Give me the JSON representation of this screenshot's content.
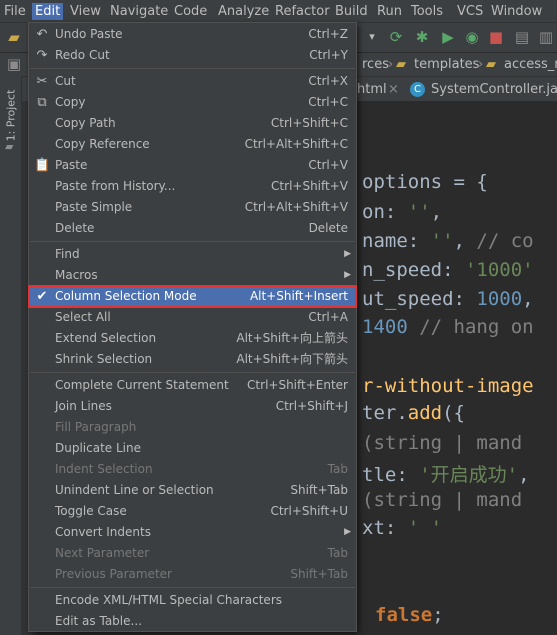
{
  "menubar": [
    "File",
    "Edit",
    "View",
    "Navigate",
    "Code",
    "Analyze",
    "Refactor",
    "Build",
    "Run",
    "Tools",
    "VCS",
    "Window"
  ],
  "breadcrumbs": [
    "rces",
    "templates",
    "access_m"
  ],
  "tabs": [
    "html",
    "SystemController.java"
  ],
  "left_tool": "1: Project",
  "code_lines": [
    [
      [
        "options = {",
        "def"
      ]
    ],
    [
      [
        "on: ",
        "def"
      ],
      [
        "''",
        "str"
      ],
      [
        ",",
        "def"
      ]
    ],
    [
      [
        "name: ",
        "def"
      ],
      [
        "''",
        "str"
      ],
      [
        ", ",
        "def"
      ],
      [
        "// co",
        "cmt"
      ]
    ],
    [
      [
        "n_speed: ",
        "def"
      ],
      [
        "'1000'",
        "str"
      ]
    ],
    [
      [
        "ut_speed: ",
        "def"
      ],
      [
        "1000",
        "num"
      ],
      [
        ",",
        "def"
      ]
    ],
    [
      [
        "1400",
        "num"
      ],
      [
        " ",
        "def"
      ],
      [
        "// hang on",
        "cmt"
      ]
    ],
    [
      [
        "r-without-image",
        "fn"
      ]
    ],
    [
      [
        "ter.",
        "def"
      ],
      [
        "add",
        "fn"
      ],
      [
        "({",
        "def"
      ]
    ],
    [
      [
        "(string | mand",
        "cmt"
      ]
    ],
    [
      [
        "tle: ",
        "def"
      ],
      [
        "'开启成功'",
        "str"
      ],
      [
        ",",
        "def"
      ]
    ],
    [
      [
        "(string | mand",
        "cmt"
      ]
    ],
    [
      [
        "xt: ",
        "def"
      ],
      [
        "' '",
        "str"
      ]
    ],
    [
      [
        "false",
        "kw"
      ],
      [
        ";",
        "def"
      ]
    ]
  ],
  "menu": [
    {
      "icon": "↶",
      "label": "Undo Paste",
      "shortcut": "Ctrl+Z"
    },
    {
      "icon": "↷",
      "label": "Redo Cut",
      "shortcut": "Ctrl+Y"
    },
    {
      "sep": true
    },
    {
      "icon": "✂",
      "label": "Cut",
      "shortcut": "Ctrl+X"
    },
    {
      "icon": "⧉",
      "label": "Copy",
      "shortcut": "Ctrl+C"
    },
    {
      "label": "Copy Path",
      "shortcut": "Ctrl+Shift+C"
    },
    {
      "label": "Copy Reference",
      "shortcut": "Ctrl+Alt+Shift+C"
    },
    {
      "icon": "📋",
      "label": "Paste",
      "shortcut": "Ctrl+V"
    },
    {
      "label": "Paste from History...",
      "shortcut": "Ctrl+Shift+V"
    },
    {
      "label": "Paste Simple",
      "shortcut": "Ctrl+Alt+Shift+V"
    },
    {
      "label": "Delete",
      "shortcut": "Delete"
    },
    {
      "sep": true
    },
    {
      "label": "Find",
      "submenu": true
    },
    {
      "label": "Macros",
      "submenu": true
    },
    {
      "icon": "✔",
      "label": "Column Selection Mode",
      "shortcut": "Alt+Shift+Insert",
      "selected": true
    },
    {
      "label": "Select All",
      "shortcut": "Ctrl+A"
    },
    {
      "label": "Extend Selection",
      "shortcut": "Alt+Shift+向上箭头"
    },
    {
      "label": "Shrink Selection",
      "shortcut": "Alt+Shift+向下箭头"
    },
    {
      "sep": true
    },
    {
      "label": "Complete Current Statement",
      "shortcut": "Ctrl+Shift+Enter"
    },
    {
      "label": "Join Lines",
      "shortcut": "Ctrl+Shift+J"
    },
    {
      "label": "Fill Paragraph",
      "disabled": true
    },
    {
      "label": "Duplicate Line"
    },
    {
      "label": "Indent Selection",
      "shortcut": "Tab",
      "disabled": true
    },
    {
      "label": "Unindent Line or Selection",
      "shortcut": "Shift+Tab"
    },
    {
      "label": "Toggle Case",
      "shortcut": "Ctrl+Shift+U"
    },
    {
      "label": "Convert Indents",
      "submenu": true
    },
    {
      "label": "Next Parameter",
      "shortcut": "Tab",
      "disabled": true
    },
    {
      "label": "Previous Parameter",
      "shortcut": "Shift+Tab",
      "disabled": true
    },
    {
      "sep": true
    },
    {
      "label": "Encode XML/HTML Special Characters"
    },
    {
      "label": "Edit as Table..."
    }
  ]
}
